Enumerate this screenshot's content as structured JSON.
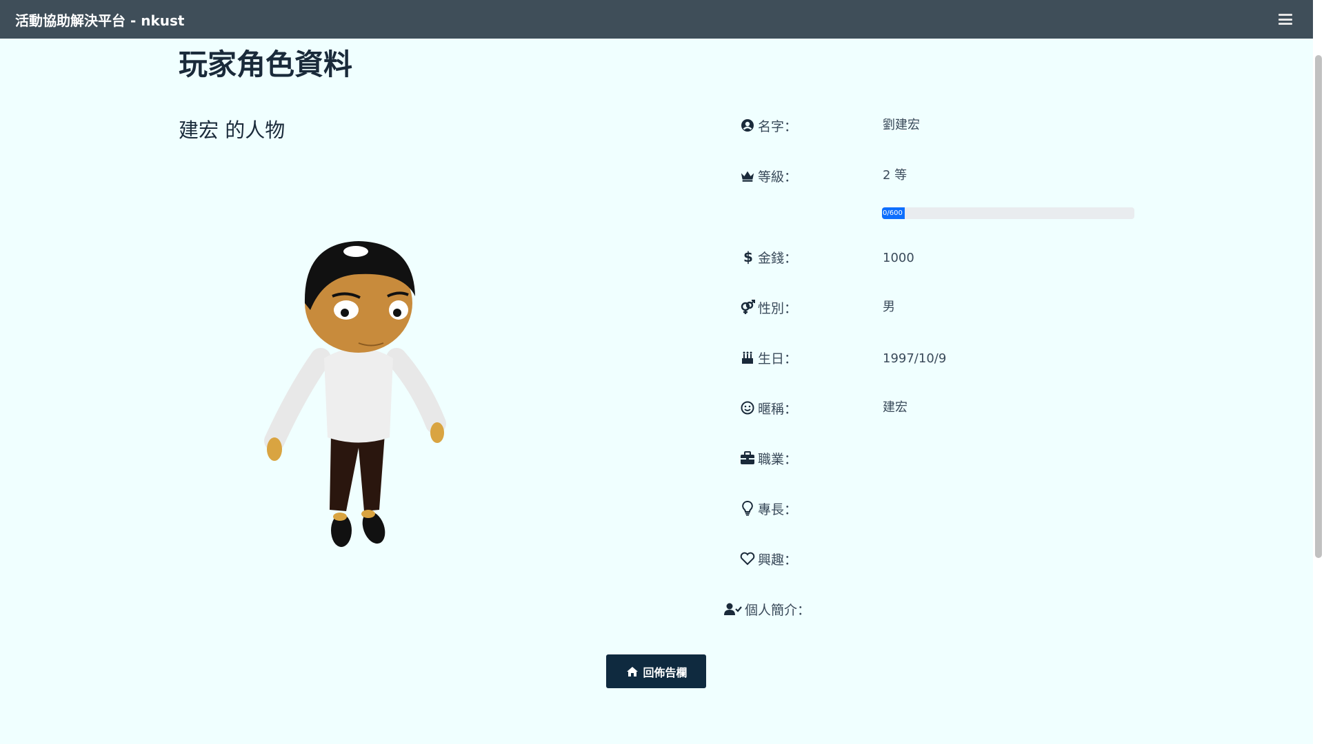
{
  "app": {
    "brand": "活動協助解決平台 - nkust"
  },
  "page": {
    "title": "玩家角色資料",
    "character_heading": "建宏 的人物"
  },
  "profile": {
    "name": {
      "label": "名字：",
      "value": "劉建宏",
      "icon": "user-circle-icon"
    },
    "level": {
      "label": "等級：",
      "value": "2 等",
      "icon": "crown-icon"
    },
    "experience": {
      "text": "0/600",
      "current": 0,
      "max": 600
    },
    "money": {
      "label": "金錢：",
      "value": "1000",
      "icon": "dollar-icon"
    },
    "gender": {
      "label": "性別：",
      "value": "男",
      "icon": "gender-icon"
    },
    "birthday": {
      "label": "生日：",
      "value": "1997/10/9",
      "icon": "birthday-cake-icon"
    },
    "nickname": {
      "label": "暱稱：",
      "value": "建宏",
      "icon": "smile-icon"
    },
    "occupation": {
      "label": "職業：",
      "value": "",
      "icon": "briefcase-icon"
    },
    "specialty": {
      "label": "專長：",
      "value": "",
      "icon": "lightbulb-icon"
    },
    "interests": {
      "label": "興趣：",
      "value": "",
      "icon": "heart-icon"
    },
    "bio": {
      "label": "個人簡介：",
      "value": "",
      "icon": "user-check-icon"
    }
  },
  "actions": {
    "back_label": "回佈告欄",
    "back_icon": "home-icon"
  },
  "colors": {
    "navbar": "#3f4e59",
    "background": "#f0ffff",
    "button": "#0f2a3f",
    "progress": "#0d6efd"
  }
}
